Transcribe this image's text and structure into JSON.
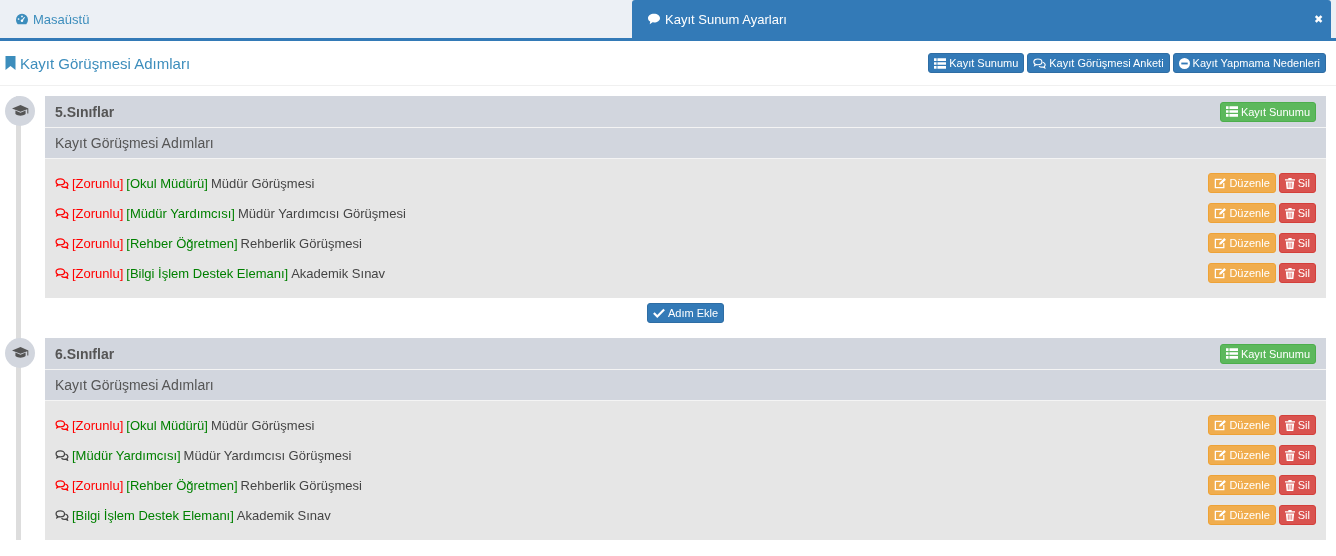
{
  "tabs": [
    {
      "label": "Masaüstü",
      "selected": false
    },
    {
      "label": "Kayıt Sunum Ayarları",
      "selected": true,
      "close": "✖"
    }
  ],
  "page_title": "Kayıt Görüşmesi Adımları",
  "header_buttons": [
    {
      "label": "Kayıt Sunumu"
    },
    {
      "label": "Kayıt Görüşmesi Anketi"
    },
    {
      "label": "Kayıt Yapmama Nedenleri"
    }
  ],
  "groups": [
    {
      "title": "5.Sınıflar",
      "action": "Kayıt Sunumu",
      "subtitle": "Kayıt Görüşmesi Adımları",
      "add_button": "Adım Ekle",
      "steps": [
        {
          "mandatory": true,
          "flag": "[Zorunlu]",
          "role": "[Okul Müdürü]",
          "title": "Müdür Görüşmesi",
          "edit": "Düzenle",
          "delete": "Sil"
        },
        {
          "mandatory": true,
          "flag": "[Zorunlu]",
          "role": "[Müdür Yardımcısı]",
          "title": "Müdür Yardımcısı Görüşmesi",
          "edit": "Düzenle",
          "delete": "Sil"
        },
        {
          "mandatory": true,
          "flag": "[Zorunlu]",
          "role": "[Rehber Öğretmen]",
          "title": "Rehberlik Görüşmesi",
          "edit": "Düzenle",
          "delete": "Sil"
        },
        {
          "mandatory": true,
          "flag": "[Zorunlu]",
          "role": "[Bilgi İşlem Destek Elemanı]",
          "title": "Akademik Sınav",
          "edit": "Düzenle",
          "delete": "Sil"
        }
      ]
    },
    {
      "title": "6.Sınıflar",
      "action": "Kayıt Sunumu",
      "subtitle": "Kayıt Görüşmesi Adımları",
      "steps": [
        {
          "mandatory": true,
          "flag": "[Zorunlu]",
          "role": "[Okul Müdürü]",
          "title": "Müdür Görüşmesi",
          "edit": "Düzenle",
          "delete": "Sil"
        },
        {
          "mandatory": false,
          "role": "[Müdür Yardımcısı]",
          "title": "Müdür Yardımcısı Görüşmesi",
          "edit": "Düzenle",
          "delete": "Sil"
        },
        {
          "mandatory": true,
          "flag": "[Zorunlu]",
          "role": "[Rehber Öğretmen]",
          "title": "Rehberlik Görüşmesi",
          "edit": "Düzenle",
          "delete": "Sil"
        },
        {
          "mandatory": false,
          "role": "[Bilgi İşlem Destek Elemanı]",
          "title": "Akademik Sınav",
          "edit": "Düzenle",
          "delete": "Sil"
        }
      ]
    }
  ]
}
